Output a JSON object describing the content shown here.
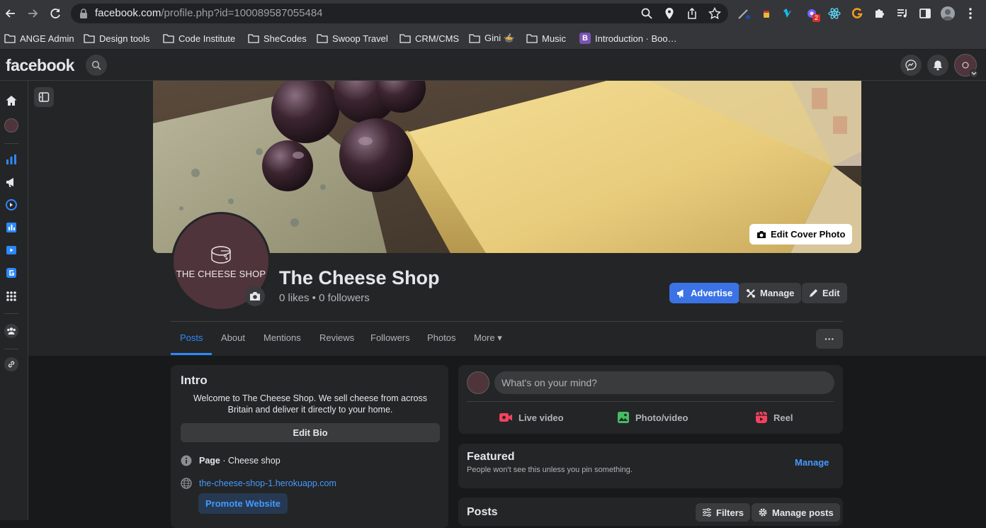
{
  "browser": {
    "url_domain": "facebook.com",
    "url_path": "/profile.php?id=100089587055484",
    "extension_badge": "2",
    "bookmarks": [
      {
        "label": "ANGE Admin",
        "icon": "folder-icon"
      },
      {
        "label": "Design tools",
        "icon": "folder-icon"
      },
      {
        "label": "Code Institute",
        "icon": "folder-icon"
      },
      {
        "label": "SheCodes",
        "icon": "folder-icon"
      },
      {
        "label": "Swoop Travel",
        "icon": "folder-icon"
      },
      {
        "label": "CRM/CMS",
        "icon": "folder-icon"
      },
      {
        "label": "Gini 🍲",
        "icon": "folder-icon"
      },
      {
        "label": "Music",
        "icon": "folder-icon"
      },
      {
        "label": "Introduction · Boo…",
        "icon": "bootstrap-icon",
        "icon_letter": "B"
      }
    ]
  },
  "header": {
    "logo": "facebook"
  },
  "page": {
    "name": "The Cheese Shop",
    "stats": "0 likes • 0 followers",
    "avatar_text": "THE CHEESE SHOP",
    "edit_cover_label": "Edit Cover Photo",
    "advertise_label": "Advertise",
    "manage_label": "Manage",
    "edit_label": "Edit",
    "more_options_label": "···"
  },
  "tabs": [
    {
      "label": "Posts",
      "active": true
    },
    {
      "label": "About"
    },
    {
      "label": "Mentions"
    },
    {
      "label": "Reviews"
    },
    {
      "label": "Followers"
    },
    {
      "label": "Photos"
    },
    {
      "label": "More ▾"
    }
  ],
  "intro": {
    "title": "Intro",
    "bio": "Welcome to The Cheese Shop. We sell cheese from across Britain and deliver it directly to your home.",
    "edit_bio_label": "Edit Bio",
    "page_label": "Page",
    "category": " · Cheese shop",
    "website": "the-cheese-shop-1.herokuapp.com",
    "promote_label": "Promote Website"
  },
  "composer": {
    "placeholder": "What's on your mind?",
    "live_label": "Live video",
    "photo_label": "Photo/video",
    "reel_label": "Reel"
  },
  "featured": {
    "title": "Featured",
    "subtitle": "People won't see this unless you pin something.",
    "manage_label": "Manage"
  },
  "posts": {
    "title": "Posts",
    "filters_label": "Filters",
    "manage_posts_label": "Manage posts"
  },
  "colors": {
    "accent_blue": "#2d88ff",
    "avatar_bg": "#4f353b",
    "surface": "#242526",
    "background": "#18191a"
  }
}
